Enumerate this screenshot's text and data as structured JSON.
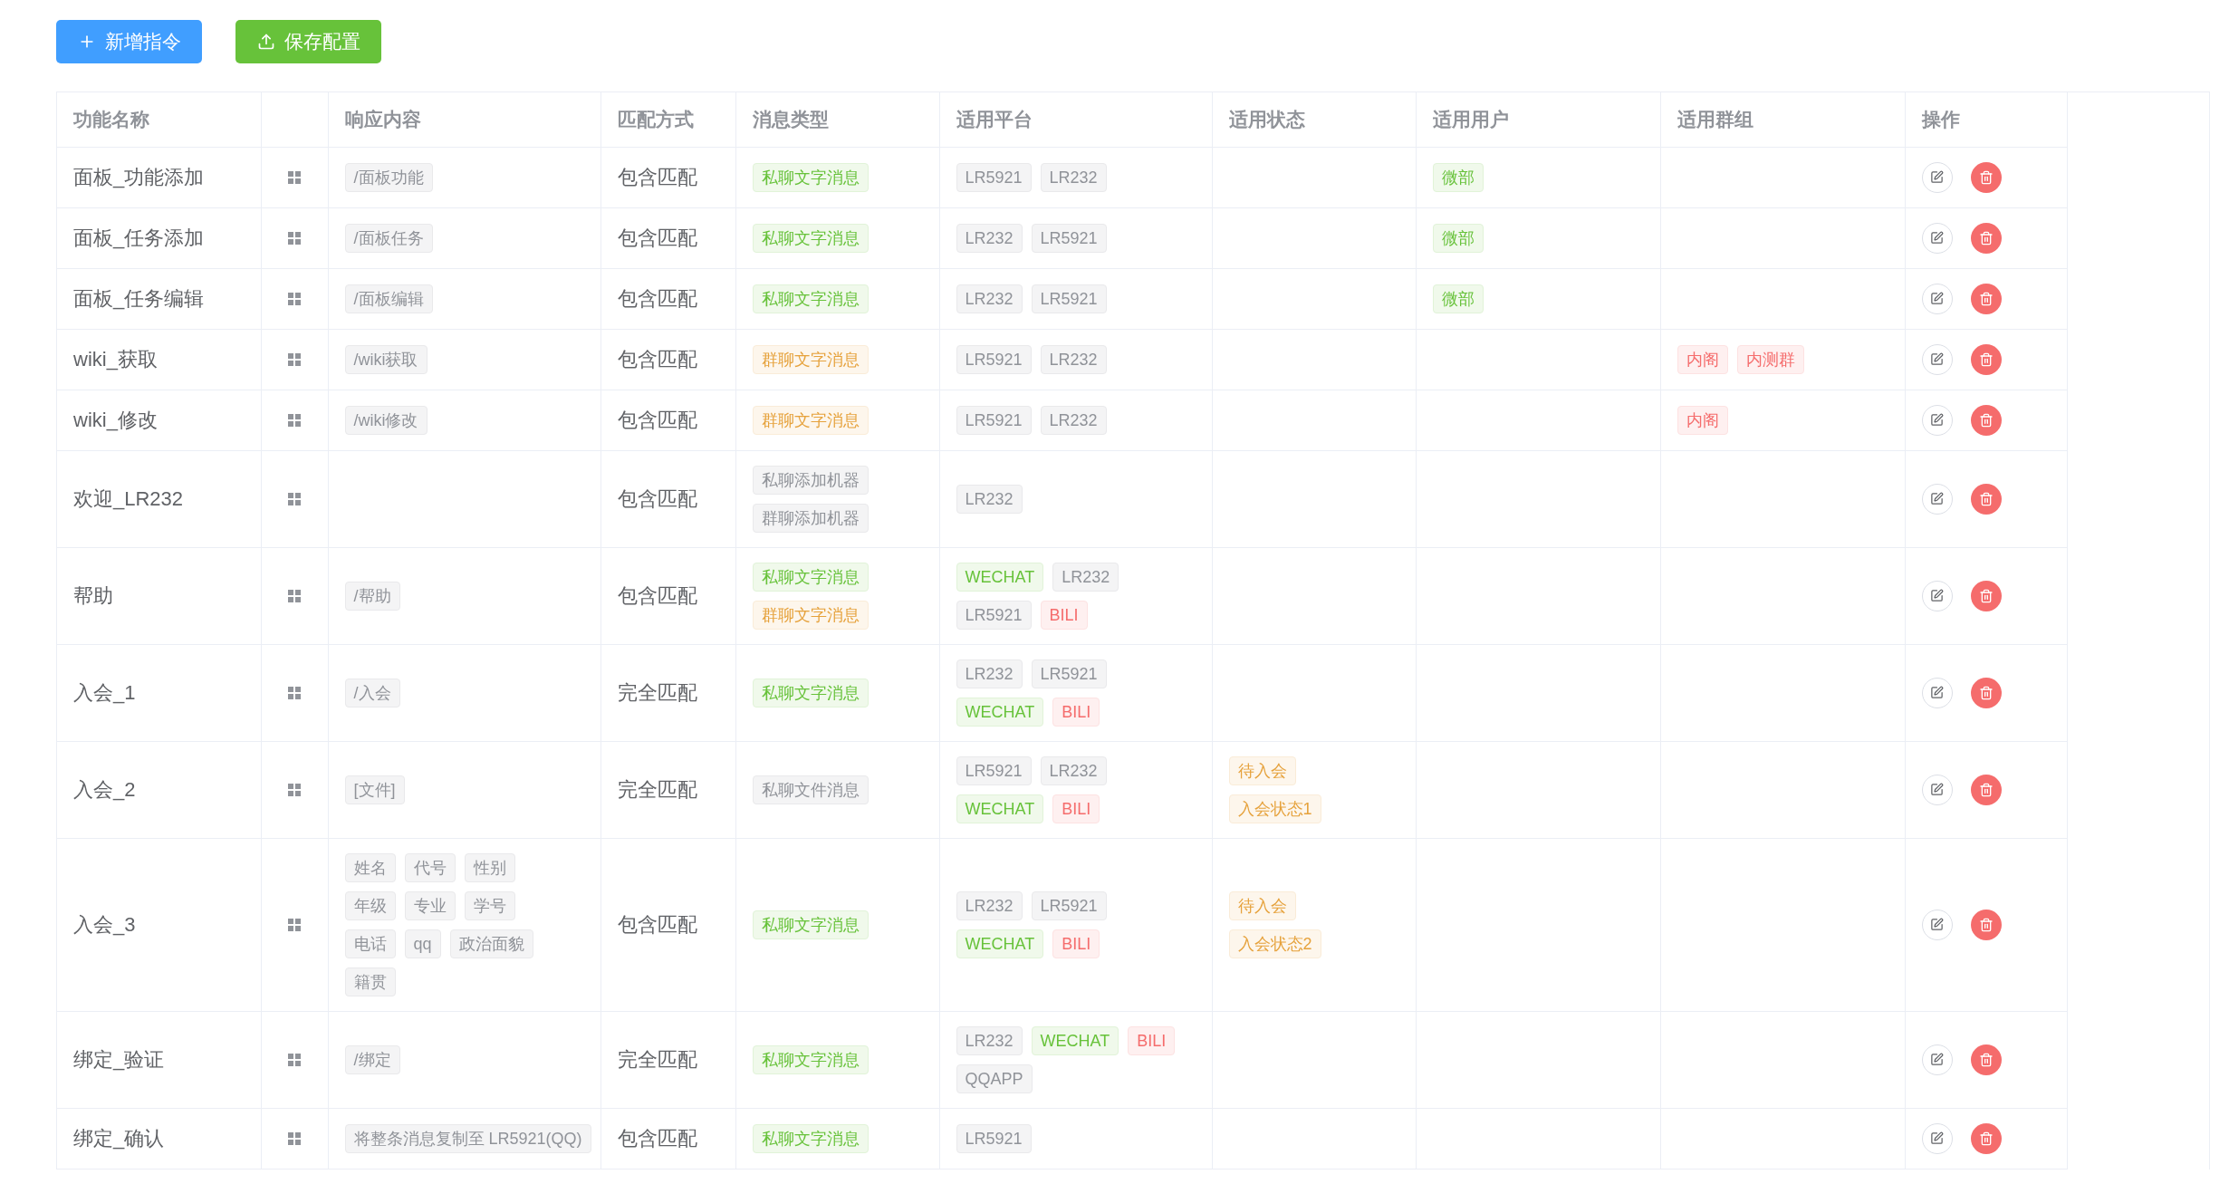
{
  "toolbar": [
    {
      "kind": "add",
      "label": "新增指令"
    },
    {
      "kind": "save",
      "label": "保存配置"
    }
  ],
  "table": {
    "columns": [
      "功能名称",
      "响应内容",
      "匹配方式",
      "消息类型",
      "适用平台",
      "适用状态",
      "适用用户",
      "适用群组",
      "操作"
    ],
    "rows": [
      {
        "name": "面板_功能添加",
        "response": [
          [
            {
              "text": "/面板功能",
              "color": "#909399"
            }
          ]
        ],
        "match": "包含匹配",
        "message_types": [
          [
            {
              "text": "私聊文字消息",
              "color": "#67c23a"
            }
          ]
        ],
        "platforms": [
          [
            {
              "text": "LR5921",
              "color": "#909399"
            },
            {
              "text": "LR232",
              "color": "#909399"
            }
          ]
        ],
        "states": [],
        "users": [
          [
            {
              "text": "微部",
              "color": "#67c23a"
            }
          ]
        ],
        "groups": []
      },
      {
        "name": "面板_任务添加",
        "response": [
          [
            {
              "text": "/面板任务",
              "color": "#909399"
            }
          ]
        ],
        "match": "包含匹配",
        "message_types": [
          [
            {
              "text": "私聊文字消息",
              "color": "#67c23a"
            }
          ]
        ],
        "platforms": [
          [
            {
              "text": "LR232",
              "color": "#909399"
            },
            {
              "text": "LR5921",
              "color": "#909399"
            }
          ]
        ],
        "states": [],
        "users": [
          [
            {
              "text": "微部",
              "color": "#67c23a"
            }
          ]
        ],
        "groups": []
      },
      {
        "name": "面板_任务编辑",
        "response": [
          [
            {
              "text": "/面板编辑",
              "color": "#909399"
            }
          ]
        ],
        "match": "包含匹配",
        "message_types": [
          [
            {
              "text": "私聊文字消息",
              "color": "#67c23a"
            }
          ]
        ],
        "platforms": [
          [
            {
              "text": "LR232",
              "color": "#909399"
            },
            {
              "text": "LR5921",
              "color": "#909399"
            }
          ]
        ],
        "states": [],
        "users": [
          [
            {
              "text": "微部",
              "color": "#67c23a"
            }
          ]
        ],
        "groups": []
      },
      {
        "name": "wiki_获取",
        "response": [
          [
            {
              "text": "/wiki获取",
              "color": "#909399"
            }
          ]
        ],
        "match": "包含匹配",
        "message_types": [
          [
            {
              "text": "群聊文字消息",
              "color": "#e6a23c"
            }
          ]
        ],
        "platforms": [
          [
            {
              "text": "LR5921",
              "color": "#909399"
            },
            {
              "text": "LR232",
              "color": "#909399"
            }
          ]
        ],
        "states": [],
        "users": [],
        "groups": [
          [
            {
              "text": "内阁",
              "color": "#f56c6c"
            },
            {
              "text": "内测群",
              "color": "#f56c6c"
            }
          ]
        ]
      },
      {
        "name": "wiki_修改",
        "response": [
          [
            {
              "text": "/wiki修改",
              "color": "#909399"
            }
          ]
        ],
        "match": "包含匹配",
        "message_types": [
          [
            {
              "text": "群聊文字消息",
              "color": "#e6a23c"
            }
          ]
        ],
        "platforms": [
          [
            {
              "text": "LR5921",
              "color": "#909399"
            },
            {
              "text": "LR232",
              "color": "#909399"
            }
          ]
        ],
        "states": [],
        "users": [],
        "groups": [
          [
            {
              "text": "内阁",
              "color": "#f56c6c"
            }
          ]
        ]
      },
      {
        "name": "欢迎_LR232",
        "response": [],
        "match": "包含匹配",
        "message_types": [
          [
            {
              "text": "私聊添加机器",
              "color": "#909399"
            }
          ],
          [
            {
              "text": "群聊添加机器",
              "color": "#909399"
            }
          ]
        ],
        "platforms": [
          [
            {
              "text": "LR232",
              "color": "#909399"
            }
          ]
        ],
        "states": [],
        "users": [],
        "groups": []
      },
      {
        "name": "帮助",
        "response": [
          [
            {
              "text": "/帮助",
              "color": "#909399"
            }
          ]
        ],
        "match": "包含匹配",
        "message_types": [
          [
            {
              "text": "私聊文字消息",
              "color": "#67c23a"
            }
          ],
          [
            {
              "text": "群聊文字消息",
              "color": "#e6a23c"
            }
          ]
        ],
        "platforms": [
          [
            {
              "text": "WECHAT",
              "color": "#67c23a"
            },
            {
              "text": "LR232",
              "color": "#909399"
            }
          ],
          [
            {
              "text": "LR5921",
              "color": "#909399"
            },
            {
              "text": "BILI",
              "color": "#f56c6c"
            }
          ]
        ],
        "states": [],
        "users": [],
        "groups": []
      },
      {
        "name": "入会_1",
        "response": [
          [
            {
              "text": "/入会",
              "color": "#909399"
            }
          ]
        ],
        "match": "完全匹配",
        "message_types": [
          [
            {
              "text": "私聊文字消息",
              "color": "#67c23a"
            }
          ]
        ],
        "platforms": [
          [
            {
              "text": "LR232",
              "color": "#909399"
            },
            {
              "text": "LR5921",
              "color": "#909399"
            }
          ],
          [
            {
              "text": "WECHAT",
              "color": "#67c23a"
            },
            {
              "text": "BILI",
              "color": "#f56c6c"
            }
          ]
        ],
        "states": [],
        "users": [],
        "groups": []
      },
      {
        "name": "入会_2",
        "response": [
          [
            {
              "text": "[文件]",
              "color": "#909399"
            }
          ]
        ],
        "match": "完全匹配",
        "message_types": [
          [
            {
              "text": "私聊文件消息",
              "color": "#909399"
            }
          ]
        ],
        "platforms": [
          [
            {
              "text": "LR5921",
              "color": "#909399"
            },
            {
              "text": "LR232",
              "color": "#909399"
            }
          ],
          [
            {
              "text": "WECHAT",
              "color": "#67c23a"
            },
            {
              "text": "BILI",
              "color": "#f56c6c"
            }
          ]
        ],
        "states": [
          [
            {
              "text": "待入会",
              "color": "#e6a23c"
            }
          ],
          [
            {
              "text": "入会状态1",
              "color": "#e6a23c"
            }
          ]
        ],
        "users": [],
        "groups": []
      },
      {
        "name": "入会_3",
        "response": [
          [
            {
              "text": "姓名",
              "color": "#909399"
            },
            {
              "text": "代号",
              "color": "#909399"
            },
            {
              "text": "性别",
              "color": "#909399"
            }
          ],
          [
            {
              "text": "年级",
              "color": "#909399"
            },
            {
              "text": "专业",
              "color": "#909399"
            },
            {
              "text": "学号",
              "color": "#909399"
            }
          ],
          [
            {
              "text": "电话",
              "color": "#909399"
            },
            {
              "text": "qq",
              "color": "#909399"
            },
            {
              "text": "政治面貌",
              "color": "#909399"
            }
          ],
          [
            {
              "text": "籍贯",
              "color": "#909399"
            }
          ]
        ],
        "match": "包含匹配",
        "message_types": [
          [
            {
              "text": "私聊文字消息",
              "color": "#67c23a"
            }
          ]
        ],
        "platforms": [
          [
            {
              "text": "LR232",
              "color": "#909399"
            },
            {
              "text": "LR5921",
              "color": "#909399"
            }
          ],
          [
            {
              "text": "WECHAT",
              "color": "#67c23a"
            },
            {
              "text": "BILI",
              "color": "#f56c6c"
            }
          ]
        ],
        "states": [
          [
            {
              "text": "待入会",
              "color": "#e6a23c"
            }
          ],
          [
            {
              "text": "入会状态2",
              "color": "#e6a23c"
            }
          ]
        ],
        "users": [],
        "groups": []
      },
      {
        "name": "绑定_验证",
        "response": [
          [
            {
              "text": "/绑定",
              "color": "#909399"
            }
          ]
        ],
        "match": "完全匹配",
        "message_types": [
          [
            {
              "text": "私聊文字消息",
              "color": "#67c23a"
            }
          ]
        ],
        "platforms": [
          [
            {
              "text": "LR232",
              "color": "#909399"
            },
            {
              "text": "WECHAT",
              "color": "#67c23a"
            },
            {
              "text": "BILI",
              "color": "#f56c6c"
            }
          ],
          [
            {
              "text": "QQAPP",
              "color": "#909399"
            }
          ]
        ],
        "states": [],
        "users": [],
        "groups": []
      },
      {
        "name": "绑定_确认",
        "response": [
          [
            {
              "text": "将整条消息复制至 LR5921(QQ)",
              "color": "#909399"
            }
          ]
        ],
        "match": "包含匹配",
        "message_types": [
          [
            {
              "text": "私聊文字消息",
              "color": "#67c23a"
            }
          ]
        ],
        "platforms": [
          [
            {
              "text": "LR5921",
              "color": "#909399"
            }
          ]
        ],
        "states": [],
        "users": [],
        "groups": []
      }
    ]
  }
}
